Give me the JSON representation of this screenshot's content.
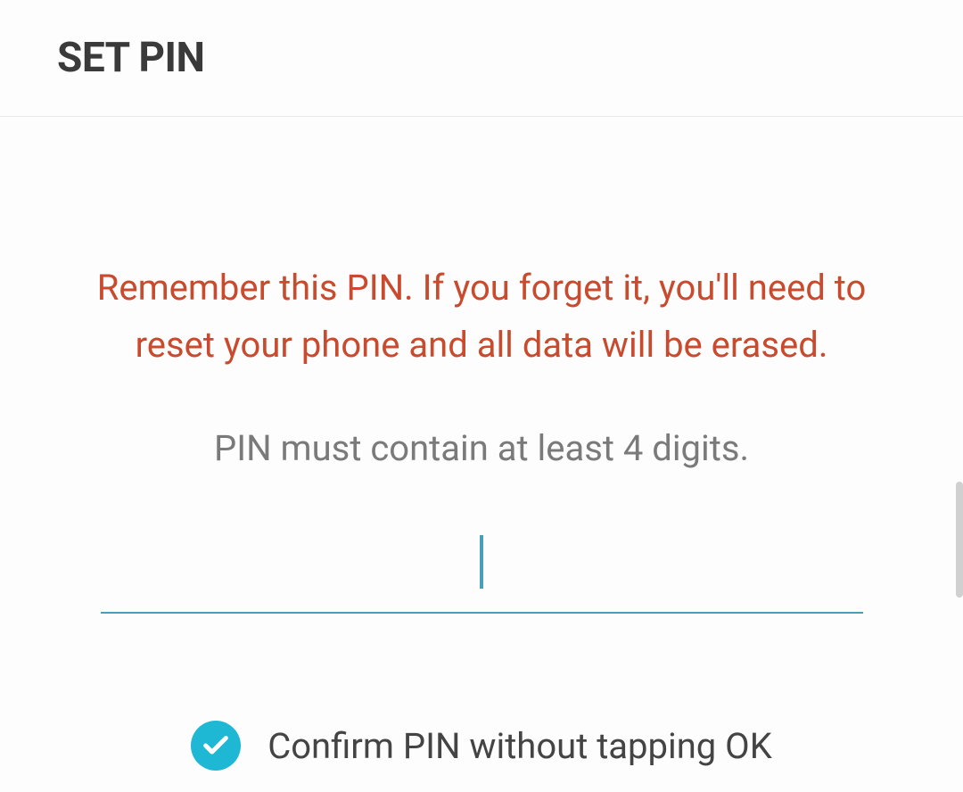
{
  "header": {
    "title": "SET PIN"
  },
  "content": {
    "warning": "Remember this PIN. If you forget it, you'll need to reset your phone and all data will be erased.",
    "hint": "PIN must contain at least 4 digits.",
    "pin_value": ""
  },
  "checkbox": {
    "label": "Confirm PIN without tapping OK",
    "checked": true
  },
  "colors": {
    "accent": "#4a9fb8",
    "warning": "#c94a2d",
    "checkbox": "#1eb8d4"
  }
}
